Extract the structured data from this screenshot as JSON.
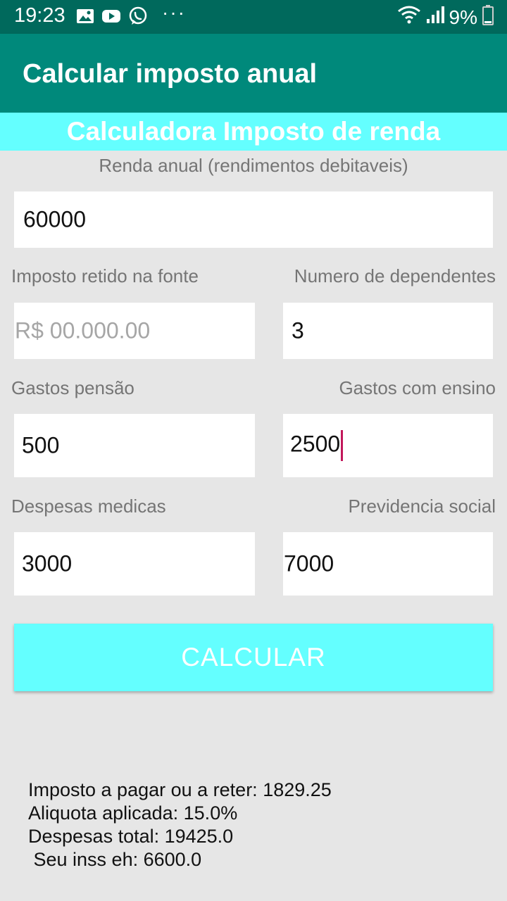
{
  "status_bar": {
    "time": "19:23",
    "battery": "9%",
    "icons": [
      "image-icon",
      "youtube-icon",
      "whatsapp-icon",
      "more-dots-icon",
      "wifi-icon",
      "signal-icon",
      "battery-icon"
    ],
    "dots": "···"
  },
  "app_bar": {
    "title": "Calcular imposto anual"
  },
  "banner": {
    "title": "Calculadora Imposto de renda"
  },
  "form": {
    "renda_label": "Renda anual (rendimentos debitaveis)",
    "renda_value": "60000",
    "imposto_label": "Imposto retido na fonte",
    "imposto_placeholder": "R$ 00.000.00",
    "dependentes_label": "Numero de dependentes",
    "dependentes_value": "3",
    "pensao_label": "Gastos pensão",
    "pensao_value": "500",
    "ensino_label": "Gastos com ensino",
    "ensino_value": "2500",
    "medicas_label": "Despesas medicas",
    "medicas_value": "3000",
    "previdencia_label": "Previdencia social",
    "previdencia_value": "7000"
  },
  "button": {
    "label": "CALCULAR"
  },
  "results": {
    "line1": "Imposto a pagar ou a reter: 1829.25",
    "line2": "Aliquota aplicada: 15.0%",
    "line3": "Despesas total: 19425.0",
    "line4": " Seu inss eh: 6600.0"
  },
  "colors": {
    "status_bar": "#00695c",
    "app_bar": "#00897b",
    "accent_cyan": "#64ffff",
    "background": "#e6e6e6",
    "cursor": "#c2185b"
  }
}
